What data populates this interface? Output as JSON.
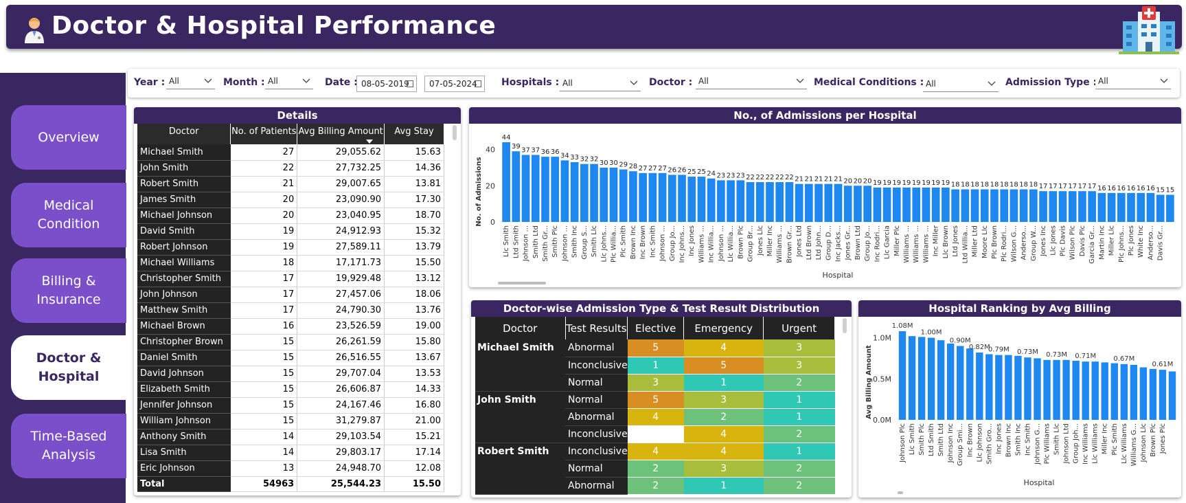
{
  "header": {
    "title": "Doctor & Hospital Performance"
  },
  "nav": {
    "items": [
      {
        "label": "Overview",
        "active": false
      },
      {
        "label": "Medical\nCondition",
        "active": false
      },
      {
        "label": "Billing &\nInsurance",
        "active": false
      },
      {
        "label": "Doctor &\nHospital",
        "active": true
      },
      {
        "label": "Time-Based\nAnalysis",
        "active": false
      }
    ]
  },
  "filters": {
    "year_label": "Year :",
    "year_value": "All",
    "month_label": "Month :",
    "month_value": "All",
    "date_label": "Date :",
    "date_from": "08-05-2019",
    "date_to": "07-05-2024",
    "hospitals_label": "Hospitals :",
    "hospitals_value": "All",
    "doctor_label": "Doctor :",
    "doctor_value": "All",
    "conditions_label": "Medical Conditions :",
    "conditions_value": "All",
    "admission_label": "Admission Type :",
    "admission_value": "All"
  },
  "details": {
    "title": "Details",
    "columns": [
      "Doctor",
      "No. of Patients",
      "Avg Billing Amount",
      "Avg Stay"
    ],
    "rows": [
      [
        "Michael Smith",
        "27",
        "29,055.62",
        "15.63"
      ],
      [
        "John Smith",
        "22",
        "27,732.25",
        "14.36"
      ],
      [
        "Robert Smith",
        "21",
        "29,007.65",
        "13.81"
      ],
      [
        "James Smith",
        "20",
        "23,090.90",
        "17.30"
      ],
      [
        "Michael Johnson",
        "20",
        "23,040.95",
        "18.70"
      ],
      [
        "David Smith",
        "19",
        "24,912.93",
        "15.32"
      ],
      [
        "Robert Johnson",
        "19",
        "27,589.11",
        "13.79"
      ],
      [
        "Michael Williams",
        "18",
        "17,171.73",
        "15.50"
      ],
      [
        "Christopher Smith",
        "17",
        "19,929.48",
        "13.12"
      ],
      [
        "John Johnson",
        "17",
        "27,457.06",
        "18.06"
      ],
      [
        "Matthew Smith",
        "17",
        "24,790.30",
        "13.76"
      ],
      [
        "Michael Brown",
        "16",
        "23,526.59",
        "19.00"
      ],
      [
        "Christopher Brown",
        "15",
        "26,261.59",
        "15.80"
      ],
      [
        "Daniel Smith",
        "15",
        "26,516.55",
        "13.67"
      ],
      [
        "David Johnson",
        "15",
        "29,707.04",
        "13.53"
      ],
      [
        "Elizabeth Smith",
        "15",
        "26,606.87",
        "14.33"
      ],
      [
        "Jennifer Johnson",
        "15",
        "24,167.46",
        "16.80"
      ],
      [
        "William Johnson",
        "15",
        "31,279.87",
        "21.00"
      ],
      [
        "Anthony Smith",
        "14",
        "29,103.54",
        "15.21"
      ],
      [
        "Lisa Smith",
        "14",
        "29,803.17",
        "17.14"
      ],
      [
        "Eric Johnson",
        "13",
        "24,948.70",
        "12.08"
      ]
    ],
    "total": [
      "Total",
      "54963",
      "25,544.23",
      "15.50"
    ]
  },
  "chart_data": [
    {
      "type": "bar",
      "title": "No., of Admissions per Hospital",
      "xlabel": "Hospital",
      "ylabel": "No. of Admissions",
      "ylim": [
        0,
        44
      ],
      "yticks": [
        "0",
        "20",
        "40"
      ],
      "grid": false,
      "categories": [
        "Llc Smith",
        "Ltd Smith",
        "Johnson ...",
        "Smith Ltd",
        "Smith Gr...",
        "Smith Plc",
        "Johnson ...",
        "Smith Inc",
        "Group S...",
        "Smith Llc",
        "Llc Johns...",
        "Plc Willia...",
        "Plc Smith",
        "Brown Inc",
        "Inc Brown",
        "Inc Smith",
        "Johnson ...",
        "Group Jo...",
        "Inc Johns...",
        "Inc Jones",
        "Williams ...",
        "Inc Willia...",
        "Johnson ...",
        "Llc Willia...",
        "Brown Plc",
        "Group Br...",
        "Jones Llc",
        "Miller Inc",
        "Williams ...",
        "Brown Gr...",
        "Jones Ltd",
        "Ltd Brown",
        "Ltd John...",
        "Group D...",
        "Inc Jacks...",
        "Jones Gr...",
        "Brown Ltd",
        "Group Jo...",
        "Inc Rodri...",
        "Llc Garcia",
        "Miller Plc",
        "Williams ...",
        "Williams ...",
        "Williams ...",
        "Inc Miller",
        "Llc Brown",
        "Ltd Jones",
        "Ltd Willia...",
        "Miller Ltd",
        "Moore Llc",
        "Plc Brown",
        "Plc Rodri...",
        "Wilson G...",
        "Anderso...",
        "Group W...",
        "Jones Inc",
        "Llc Jones",
        "Plc Davis",
        "Wilson Plc",
        "Davis Plc",
        "Garcia Gr...",
        "Martin Inc",
        "Miller Llc",
        "Plc Johns...",
        "Plc Jones",
        "White Inc",
        "Anderso...",
        "Davis Gr..."
      ],
      "values": [
        44,
        39,
        37,
        37,
        36,
        36,
        34,
        33,
        32,
        32,
        30,
        30,
        29,
        28,
        27,
        27,
        27,
        26,
        26,
        25,
        25,
        24,
        23,
        23,
        23,
        22,
        22,
        22,
        22,
        22,
        21,
        21,
        21,
        21,
        21,
        20,
        20,
        20,
        19,
        19,
        19,
        19,
        19,
        19,
        19,
        19,
        18,
        18,
        18,
        18,
        18,
        18,
        18,
        18,
        18,
        17,
        17,
        17,
        17,
        17,
        17,
        16,
        16,
        16,
        16,
        16,
        16,
        15,
        15
      ]
    },
    {
      "type": "bar",
      "title": "Hospital Ranking by Avg Billing",
      "xlabel": "Hospital",
      "ylabel": "Avg Billing Amount",
      "ylim": [
        0,
        1.08
      ],
      "yticks": [
        "0.0M",
        "0.5M",
        "1.0M"
      ],
      "grid": false,
      "categories": [
        "Johnson Plc",
        "Llc Smith",
        "Smith Plc",
        "Ltd Smith",
        "Smith Ltd",
        "Johnson Inc",
        "Group Smi...",
        "Inc Brown",
        "Llc Johnson",
        "Smith Gro...",
        "Inc Jones",
        "Brown Inc",
        "Smith Inc",
        "Inc Smith",
        "Johnson G...",
        "Plc Williams",
        "Smith Llc",
        "Johnson Ltd",
        "Group Joh...",
        "Inc Williams",
        "Llc Williams",
        "Miller Inc",
        "Plc Smith",
        "Llc Williams",
        "Williams G...",
        "Johnson Llc",
        "Brown Plc",
        "Jones Plc"
      ],
      "values": [
        1.08,
        1.02,
        1.01,
        1.0,
        0.97,
        0.93,
        0.9,
        0.87,
        0.82,
        0.8,
        0.79,
        0.79,
        0.78,
        0.76,
        0.75,
        0.73,
        0.73,
        0.73,
        0.72,
        0.71,
        0.71,
        0.7,
        0.69,
        0.68,
        0.67,
        0.64,
        0.62,
        0.61,
        0.59
      ],
      "data_labels": [
        "1.08M",
        "1.00M",
        "0.90M",
        "0.82M",
        "0.79M",
        "0.73M",
        "0.73M",
        "0.71M",
        "0.67M",
        "0.61M"
      ]
    }
  ],
  "heatmap": {
    "title": "Doctor-wise Admission Type & Test Result Distribution",
    "columns": [
      "Doctor",
      "Test Results",
      "Elective",
      "Emergency",
      "Urgent"
    ],
    "groups": [
      {
        "doctor": "Michael Smith",
        "rows": [
          {
            "result": "Abnormal",
            "values": [
              5,
              4,
              3
            ]
          },
          {
            "result": "Inconclusive",
            "values": [
              1,
              5,
              3
            ]
          },
          {
            "result": "Normal",
            "values": [
              3,
              1,
              2
            ]
          }
        ]
      },
      {
        "doctor": "John Smith",
        "rows": [
          {
            "result": "Normal",
            "values": [
              5,
              3,
              1
            ]
          },
          {
            "result": "Abnormal",
            "values": [
              4,
              2,
              1
            ]
          },
          {
            "result": "Inconclusive",
            "values": [
              null,
              4,
              2
            ]
          }
        ]
      },
      {
        "doctor": "Robert Smith",
        "rows": [
          {
            "result": "Inconclusive",
            "values": [
              4,
              4,
              1
            ]
          },
          {
            "result": "Normal",
            "values": [
              2,
              3,
              2
            ]
          },
          {
            "result": "Abnormal",
            "values": [
              2,
              1,
              2
            ]
          }
        ]
      }
    ],
    "colors": {
      "1": "#2ec8b4",
      "2": "#6cc27a",
      "3": "#a9bd3d",
      "4": "#d8b40e",
      "5": "#d88e22",
      "empty": "#ffffff"
    }
  },
  "colors": {
    "brand": "#3a2660",
    "nav_button": "#7b4fc9",
    "bar": "#1e88f0"
  }
}
